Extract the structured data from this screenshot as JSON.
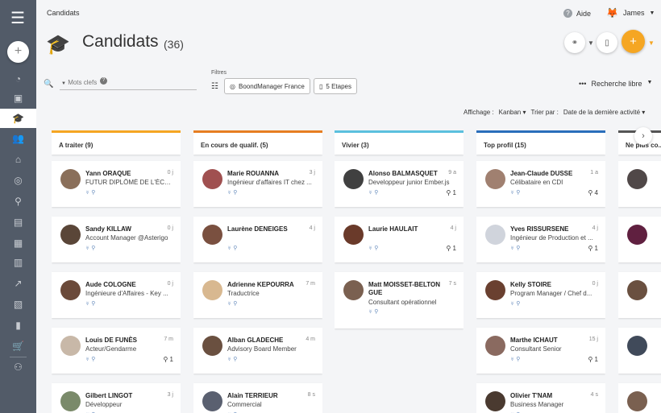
{
  "breadcrumb": "Candidats",
  "help": "Aide",
  "user": "James",
  "title": "Candidats",
  "count": "(36)",
  "filters_label": "Filtres",
  "keywords_placeholder": "Mots clefs",
  "chips": [
    "BoondManager France",
    "5 Etapes"
  ],
  "advanced": "Recherche libre",
  "display_label": "Affichage :",
  "display_value": "Kanban",
  "sort_label": "Trier par :",
  "sort_value": "Date de la dernière activité",
  "columns": [
    {
      "title": "A traiter (9)",
      "color": "#f5a623",
      "cards": [
        {
          "name": "Yann ORAQUE",
          "age": "0 j",
          "role": "FUTUR DIPLÔMÉ DE L'ÉCOL...",
          "pin": "",
          "av": "#8a6f5a"
        },
        {
          "name": "Sandy KILLAW",
          "age": "0 j",
          "role": "Account Manager @Asterigo",
          "pin": "",
          "av": "#5a4638"
        },
        {
          "name": "Aude COLOGNE",
          "age": "0 j",
          "role": "Ingénieure d'Affaires - Key ...",
          "pin": "",
          "av": "#6b4a3a"
        },
        {
          "name": "Louis DE FUNÈS",
          "age": "7 m",
          "role": "Acteur/Gendarme",
          "pin": "1",
          "av": "#c8b8a8"
        },
        {
          "name": "Gilbert LINGOT",
          "age": "3 j",
          "role": "Développeur",
          "pin": "",
          "av": "#7a8a6a"
        }
      ]
    },
    {
      "title": "En cours de qualif. (5)",
      "color": "#e67e22",
      "cards": [
        {
          "name": "Marie ROUANNA",
          "age": "3 j",
          "role": "Ingénieur d'affaires IT chez ...",
          "pin": "",
          "av": "#a05050"
        },
        {
          "name": "Laurène DENEIGES",
          "age": "4 j",
          "role": "",
          "pin": "",
          "av": "#7a5040"
        },
        {
          "name": "Adrienne KEPOURRA",
          "age": "7 m",
          "role": "Traductrice",
          "pin": "",
          "av": "#d8b890"
        },
        {
          "name": "Alban GLADECHE",
          "age": "4 m",
          "role": "Advisory Board Member",
          "pin": "",
          "av": "#6a5040"
        },
        {
          "name": "Alain TERRIEUR",
          "age": "8 s",
          "role": "Commercial",
          "pin": "",
          "av": "#5a6070"
        }
      ]
    },
    {
      "title": "Vivier (3)",
      "color": "#5bc0de",
      "cards": [
        {
          "name": "Alonso BALMASQUET",
          "age": "9 a",
          "role": "Developpeur junior Ember.js",
          "pin": "1",
          "av": "#404040"
        },
        {
          "name": "Laurie HAULAIT",
          "age": "4 j",
          "role": "",
          "pin": "1",
          "av": "#6a3a2a"
        },
        {
          "name": "Matt MOISSET-BELTON GUE",
          "age": "7 s",
          "role": "Consultant opérationnel",
          "pin": "",
          "av": "#7a6050"
        }
      ]
    },
    {
      "title": "Top profil (15)",
      "color": "#2a6ebb",
      "cards": [
        {
          "name": "Jean-Claude DUSSE",
          "age": "1 a",
          "role": "Célibataire en CDI",
          "pin": "4",
          "av": "#a08070"
        },
        {
          "name": "Yves RISSURSENE",
          "age": "4 j",
          "role": "Ingénieur de Production et ...",
          "pin": "1",
          "av": "#d0d4dc"
        },
        {
          "name": "Kelly STOIRE",
          "age": "0 j",
          "role": "Program Manager / Chef d...",
          "pin": "",
          "av": "#6a4030"
        },
        {
          "name": "Marthe ICHAUT",
          "age": "15 j",
          "role": "Consultant Senior",
          "pin": "1",
          "av": "#8a6a60"
        },
        {
          "name": "Olivier T'NAM",
          "age": "4 s",
          "role": "Business Manager",
          "pin": "",
          "av": "#4a3a30"
        }
      ]
    },
    {
      "title": "Ne plus co...",
      "color": "#555555",
      "cards": [
        {
          "name": "",
          "age": "",
          "role": "",
          "pin": "",
          "av": "#504848"
        },
        {
          "name": "",
          "age": "",
          "role": "",
          "pin": "",
          "av": "#602040"
        },
        {
          "name": "",
          "age": "",
          "role": "",
          "pin": "",
          "av": "#6a5040"
        },
        {
          "name": "",
          "age": "",
          "role": "",
          "pin": "",
          "av": "#404a5a"
        },
        {
          "name": "",
          "age": "",
          "role": "",
          "pin": "",
          "av": "#7a6050"
        }
      ]
    }
  ]
}
